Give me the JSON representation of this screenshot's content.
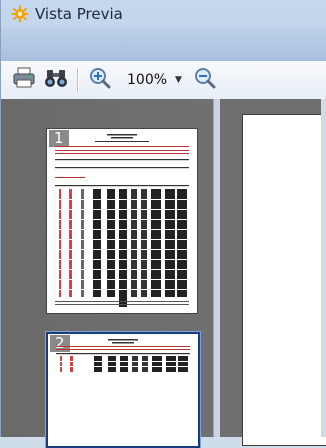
{
  "window": {
    "title": "Vista Previa"
  },
  "toolbar": {
    "zoom_value": "100%"
  },
  "icons": {
    "app": "gear-sun-icon",
    "print": "printer-icon",
    "find": "binoculars-icon",
    "zoom_in": "zoom-in-icon",
    "zoom_out": "zoom-out-icon"
  },
  "thumbnails": [
    {
      "number": "1",
      "selected": false
    },
    {
      "number": "2",
      "selected": true
    }
  ],
  "colors": {
    "selection": "#1c3b7a",
    "title_bar": "#c5d7ec",
    "panel_bg": "#6b6b6b"
  }
}
